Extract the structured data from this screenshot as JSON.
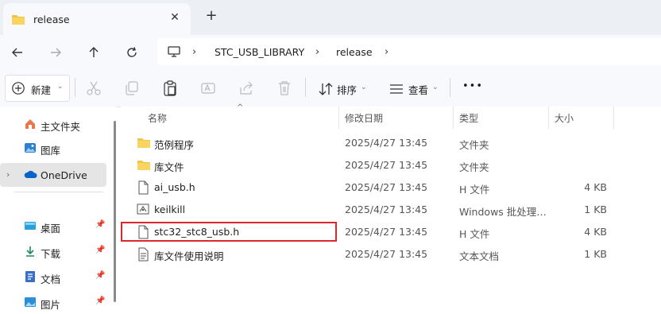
{
  "tab": {
    "title": "release",
    "close_glyph": "✕",
    "new_tab_glyph": "+"
  },
  "address": {
    "segments": [
      "STC_USB_LIBRARY",
      "release"
    ]
  },
  "toolbar": {
    "new_label": "新建",
    "sort_label": "排序",
    "view_label": "查看",
    "more_label": "•••"
  },
  "sidebar": {
    "items": [
      {
        "label": "主文件夹",
        "icon": "home-icon"
      },
      {
        "label": "图库",
        "icon": "gallery-icon"
      },
      {
        "label": "OneDrive",
        "icon": "onedrive-icon",
        "selected": true
      },
      {
        "label": "桌面",
        "icon": "desktop-icon",
        "pinned": true
      },
      {
        "label": "下载",
        "icon": "download-icon",
        "pinned": true
      },
      {
        "label": "文档",
        "icon": "documents-icon",
        "pinned": true
      },
      {
        "label": "图片",
        "icon": "pictures-icon",
        "pinned": true
      }
    ]
  },
  "columns": {
    "name": "名称",
    "date": "修改日期",
    "type": "类型",
    "size": "大小"
  },
  "files": [
    {
      "name": "范例程序",
      "date": "2025/4/27 13:45",
      "type": "文件夹",
      "size": "",
      "icon": "folder-icon"
    },
    {
      "name": "库文件",
      "date": "2025/4/27 13:45",
      "type": "文件夹",
      "size": "",
      "icon": "folder-icon"
    },
    {
      "name": "ai_usb.h",
      "date": "2025/4/27 13:45",
      "type": "H 文件",
      "size": "4 KB",
      "icon": "file-icon"
    },
    {
      "name": "keilkill",
      "date": "2025/4/27 13:45",
      "type": "Windows 批处理…",
      "size": "1 KB",
      "icon": "batch-file-icon"
    },
    {
      "name": "stc32_stc8_usb.h",
      "date": "2025/4/27 13:45",
      "type": "H 文件",
      "size": "4 KB",
      "icon": "file-icon",
      "highlighted": true
    },
    {
      "name": "库文件使用说明",
      "date": "2025/4/27 13:45",
      "type": "文本文档",
      "size": "1 KB",
      "icon": "text-file-icon"
    }
  ],
  "colors": {
    "accent": "#0067c0",
    "folder": "#f4c245",
    "highlight_border": "#d9292f",
    "selected_bg": "#e5e5e5"
  }
}
